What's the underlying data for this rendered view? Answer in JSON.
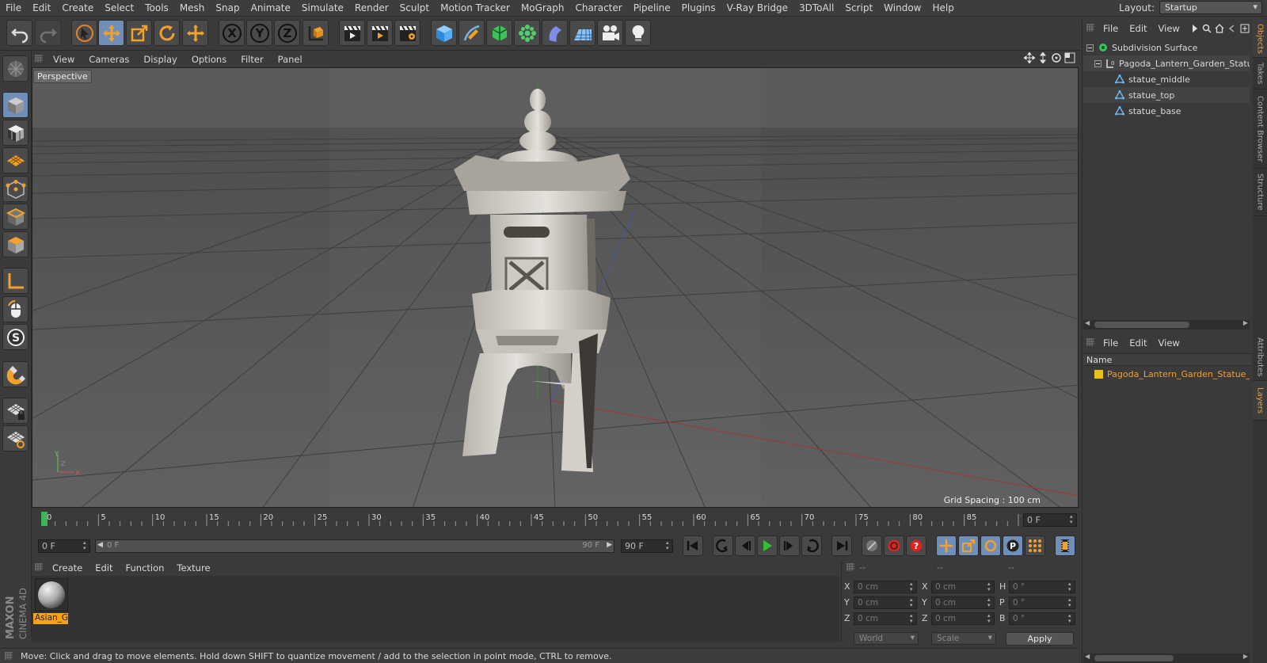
{
  "menu": {
    "items": [
      "File",
      "Edit",
      "Create",
      "Select",
      "Tools",
      "Mesh",
      "Snap",
      "Animate",
      "Simulate",
      "Render",
      "Sculpt",
      "Motion Tracker",
      "MoGraph",
      "Character",
      "Pipeline",
      "Plugins",
      "V-Ray Bridge",
      "3DToAll",
      "Script",
      "Window",
      "Help"
    ],
    "layout_label": "Layout:",
    "layout_value": "Startup"
  },
  "toolbar": {
    "axis_x": "X",
    "axis_y": "Y",
    "axis_z": "Z"
  },
  "viewport": {
    "menu": [
      "View",
      "Cameras",
      "Display",
      "Options",
      "Filter",
      "Panel"
    ],
    "camera_label": "Perspective",
    "grid_spacing": "Grid Spacing : 100 cm",
    "axis_y": "Y",
    "axis_x": "X",
    "axis_z": "Z"
  },
  "timeline": {
    "ticks": [
      "0",
      "5",
      "10",
      "15",
      "20",
      "25",
      "30",
      "35",
      "40",
      "45",
      "50",
      "55",
      "60",
      "65",
      "70",
      "75",
      "80",
      "85",
      "90"
    ],
    "current_frame_right": "0 F",
    "start_frame": "0 F",
    "range_start": "0 F",
    "range_end": "90 F",
    "end_frame": "90 F",
    "playhead": 0,
    "max": 90
  },
  "material_manager": {
    "menu": [
      "Create",
      "Edit",
      "Function",
      "Texture"
    ],
    "material_name": "Asian_G"
  },
  "coordinates": {
    "header": [
      "--",
      "--",
      "--"
    ],
    "rows": [
      {
        "l1": "X",
        "v1": "0 cm",
        "l2": "X",
        "v2": "0 cm",
        "l3": "H",
        "v3": "0 °"
      },
      {
        "l1": "Y",
        "v1": "0 cm",
        "l2": "Y",
        "v2": "0 cm",
        "l3": "P",
        "v3": "0 °"
      },
      {
        "l1": "Z",
        "v1": "0 cm",
        "l2": "Z",
        "v2": "0 cm",
        "l3": "B",
        "v3": "0 °"
      }
    ],
    "mode_world": "World",
    "mode_scale": "Scale",
    "apply_label": "Apply"
  },
  "status": {
    "text": "Move: Click and drag to move elements. Hold down SHIFT to quantize movement / add to the selection in point mode, CTRL to remove."
  },
  "objects_panel": {
    "menu": [
      "File",
      "Edit",
      "View"
    ],
    "items": [
      {
        "name": "Subdivision Surface",
        "color": "#7fd08a"
      },
      {
        "name": "Pagoda_Lantern_Garden_Statue_",
        "color": "#cfcfcf"
      },
      {
        "name": "statue_middle",
        "color": "#6fb3e8"
      },
      {
        "name": "statue_top",
        "color": "#6fb3e8"
      },
      {
        "name": "statue_base",
        "color": "#6fb3e8"
      }
    ]
  },
  "layers_panel": {
    "menu": [
      "File",
      "Edit",
      "View"
    ],
    "column_name": "Name",
    "layer_name": "Pagoda_Lantern_Garden_Statue_V",
    "layer_color": "#e8c21a"
  },
  "side_tabs": [
    "Objects",
    "Takes",
    "Content Browser",
    "Structure",
    "Attributes",
    "Layers"
  ],
  "brand": {
    "maxon": "MAXON",
    "cinema": "CINEMA 4D"
  },
  "colors": {
    "accent": "#f0a030",
    "selected_tool": "#6f8fb8"
  }
}
